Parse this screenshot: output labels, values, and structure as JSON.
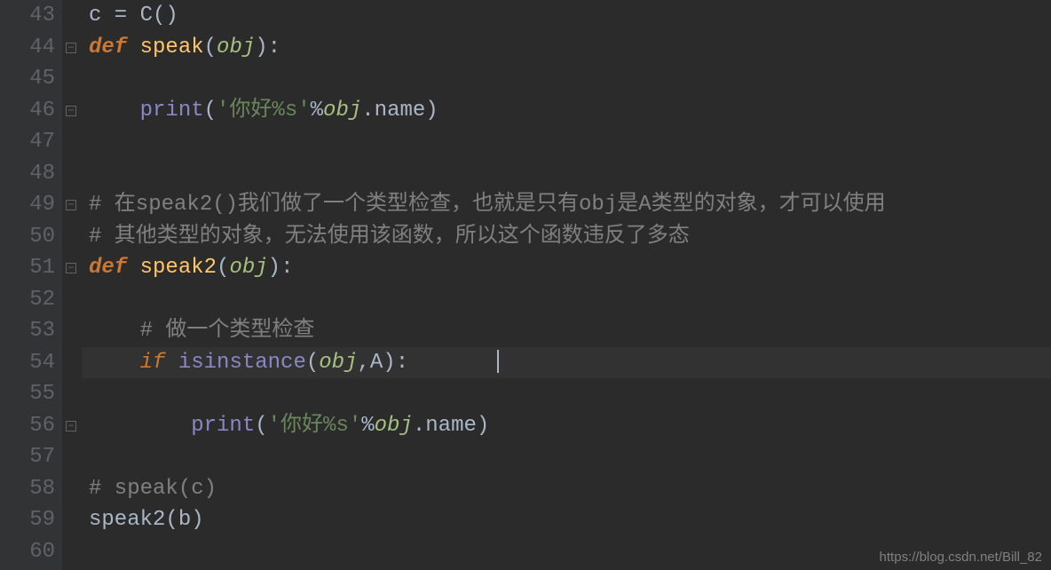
{
  "watermark": "https://blog.csdn.net/Bill_82",
  "lines": [
    {
      "num": "43",
      "indent": 0,
      "tokens": [
        {
          "t": "c",
          "c": "tok-var"
        },
        {
          "t": " = ",
          "c": "tok-op"
        },
        {
          "t": "C",
          "c": "tok-class"
        },
        {
          "t": "()",
          "c": "tok-punc"
        }
      ]
    },
    {
      "num": "44",
      "indent": 0,
      "fold": true,
      "tokens": [
        {
          "t": "def",
          "c": "tok-keyword-b"
        },
        {
          "t": " ",
          "c": "tok-op"
        },
        {
          "t": "speak",
          "c": "tok-def"
        },
        {
          "t": "(",
          "c": "tok-punc"
        },
        {
          "t": "obj",
          "c": "tok-param"
        },
        {
          "t": ")",
          "c": "tok-punc"
        },
        {
          "t": ":",
          "c": "tok-op"
        }
      ]
    },
    {
      "num": "45",
      "indent": 1,
      "tokens": []
    },
    {
      "num": "46",
      "indent": 1,
      "fold": true,
      "tokens": [
        {
          "t": "    ",
          "c": ""
        },
        {
          "t": "print",
          "c": "tok-builtin"
        },
        {
          "t": "(",
          "c": "tok-punc"
        },
        {
          "t": "'你好%s'",
          "c": "tok-str"
        },
        {
          "t": "%",
          "c": "tok-op"
        },
        {
          "t": "obj",
          "c": "tok-param"
        },
        {
          "t": ".name",
          "c": "tok-var"
        },
        {
          "t": ")",
          "c": "tok-punc"
        }
      ]
    },
    {
      "num": "47",
      "indent": 0,
      "tokens": []
    },
    {
      "num": "48",
      "indent": 0,
      "tokens": []
    },
    {
      "num": "49",
      "indent": 0,
      "fold": true,
      "tokens": [
        {
          "t": "# 在speak2()我们做了一个类型检查，也就是只有obj是A类型的对象，才可以使用",
          "c": "tok-comment"
        }
      ]
    },
    {
      "num": "50",
      "indent": 0,
      "tokens": [
        {
          "t": "# 其他类型的对象，无法使用该函数，所以这个函数违反了多态",
          "c": "tok-comment"
        }
      ]
    },
    {
      "num": "51",
      "indent": 0,
      "fold": true,
      "tokens": [
        {
          "t": "def",
          "c": "tok-keyword-b"
        },
        {
          "t": " ",
          "c": "tok-op"
        },
        {
          "t": "speak2",
          "c": "tok-def"
        },
        {
          "t": "(",
          "c": "tok-punc"
        },
        {
          "t": "obj",
          "c": "tok-param"
        },
        {
          "t": ")",
          "c": "tok-punc"
        },
        {
          "t": ":",
          "c": "tok-op"
        }
      ]
    },
    {
      "num": "52",
      "indent": 1,
      "tokens": []
    },
    {
      "num": "53",
      "indent": 1,
      "tokens": [
        {
          "t": "    ",
          "c": ""
        },
        {
          "t": "# 做一个类型检查",
          "c": "tok-comment"
        }
      ]
    },
    {
      "num": "54",
      "indent": 1,
      "hl": true,
      "caret": true,
      "tokens": [
        {
          "t": "    ",
          "c": ""
        },
        {
          "t": "if",
          "c": "tok-keyword"
        },
        {
          "t": " ",
          "c": "tok-op"
        },
        {
          "t": "isinstance",
          "c": "tok-builtin"
        },
        {
          "t": "(",
          "c": "tok-punc"
        },
        {
          "t": "obj",
          "c": "tok-param"
        },
        {
          "t": ",",
          "c": "tok-punc"
        },
        {
          "t": "A",
          "c": "tok-class"
        },
        {
          "t": ")",
          "c": "tok-punc"
        },
        {
          "t": ":",
          "c": "tok-op"
        }
      ]
    },
    {
      "num": "55",
      "indent": 2,
      "tokens": []
    },
    {
      "num": "56",
      "indent": 2,
      "fold": true,
      "tokens": [
        {
          "t": "        ",
          "c": ""
        },
        {
          "t": "print",
          "c": "tok-builtin"
        },
        {
          "t": "(",
          "c": "tok-punc"
        },
        {
          "t": "'你好%s'",
          "c": "tok-str"
        },
        {
          "t": "%",
          "c": "tok-op"
        },
        {
          "t": "obj",
          "c": "tok-param"
        },
        {
          "t": ".name",
          "c": "tok-var"
        },
        {
          "t": ")",
          "c": "tok-punc"
        }
      ]
    },
    {
      "num": "57",
      "indent": 0,
      "tokens": []
    },
    {
      "num": "58",
      "indent": 0,
      "tokens": [
        {
          "t": "# speak(c)",
          "c": "tok-comment"
        }
      ]
    },
    {
      "num": "59",
      "indent": 0,
      "tokens": [
        {
          "t": "speak2",
          "c": "tok-func-call"
        },
        {
          "t": "(",
          "c": "tok-punc"
        },
        {
          "t": "b",
          "c": "tok-var"
        },
        {
          "t": ")",
          "c": "tok-punc"
        }
      ]
    },
    {
      "num": "60",
      "indent": 0,
      "tokens": []
    }
  ]
}
